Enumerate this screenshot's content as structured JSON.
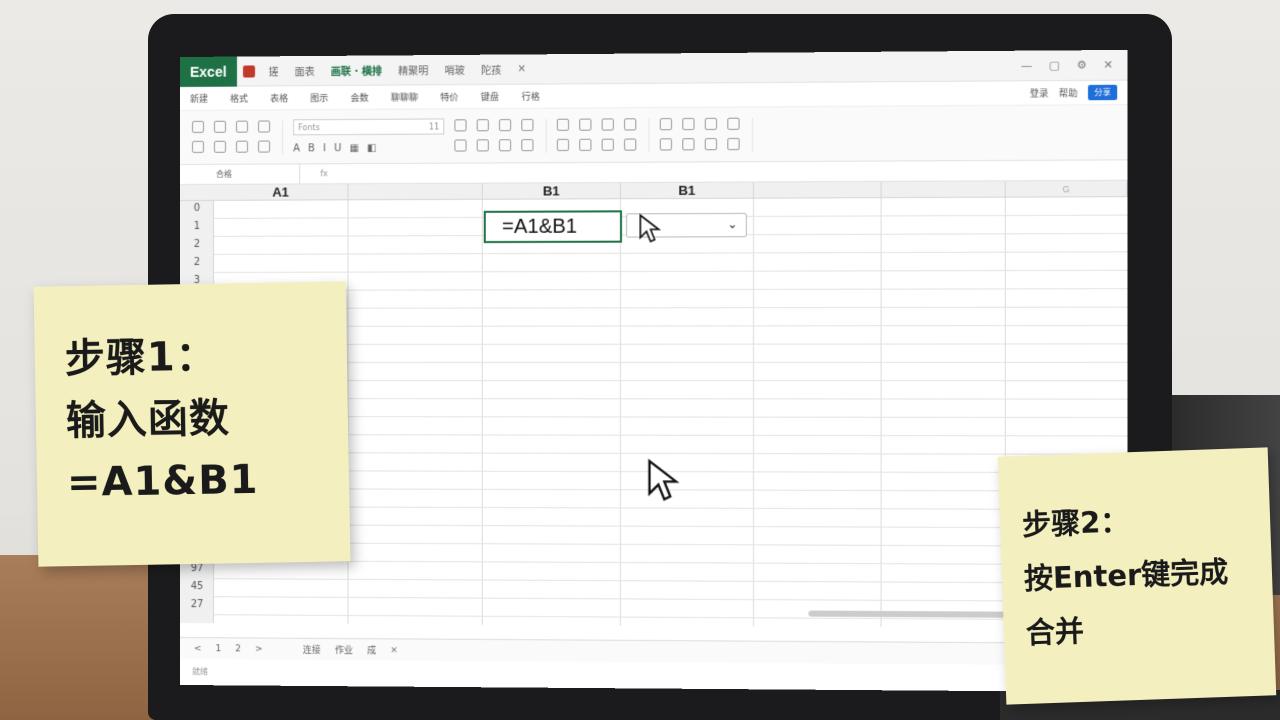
{
  "titlebar": {
    "app_name": "Excel",
    "tabs": [
      "搓",
      "面表",
      "画联 · 横排",
      "精聚明",
      "哨玻",
      "陀孩"
    ],
    "active_tab_index": 2
  },
  "menubar": {
    "items": [
      "新建",
      "格式",
      "表格",
      "图示",
      "会数",
      "聊聊聊",
      "特价",
      "键盘",
      "行格"
    ],
    "right_items": [
      "登录",
      "帮助"
    ],
    "share_label": "分享"
  },
  "toolbar": {
    "font_name": "Fonts",
    "font_size": "11"
  },
  "formula_bar": {
    "name_box": "合格",
    "fx_placeholder": "fx"
  },
  "grid": {
    "column_headers": [
      {
        "label": "A1",
        "emphasis": true
      },
      {
        "label": "",
        "emphasis": false
      },
      {
        "label": "B1",
        "emphasis": true
      },
      {
        "label": "B1",
        "emphasis": true
      },
      {
        "label": "",
        "emphasis": false
      },
      {
        "label": "",
        "emphasis": false
      },
      {
        "label": "G",
        "emphasis": false
      }
    ],
    "row_numbers": [
      "0",
      "1",
      "2",
      "2",
      "3",
      "",
      "",
      "",
      "",
      "",
      "",
      "",
      "",
      "",
      "",
      "",
      "",
      "",
      "",
      "20",
      "97",
      "45",
      "27"
    ],
    "active_cell_formula": "=A1&B1",
    "dropdown_arrow": "⌄"
  },
  "sheetbar": {
    "nav": [
      "<",
      "1",
      "2",
      ">"
    ],
    "sheets": [
      "连接",
      "作业",
      "成"
    ]
  },
  "statusbar": {
    "text": "就绪"
  },
  "notes": {
    "step1_lines": [
      "步骤1：",
      "输入函数",
      "=A1&B1"
    ],
    "step2_lines": [
      "步骤2：",
      "按Enter键完成",
      "合并"
    ]
  },
  "colors": {
    "accent": "#1e7145",
    "note": "#f3efbe",
    "share": "#1e6fd9"
  }
}
